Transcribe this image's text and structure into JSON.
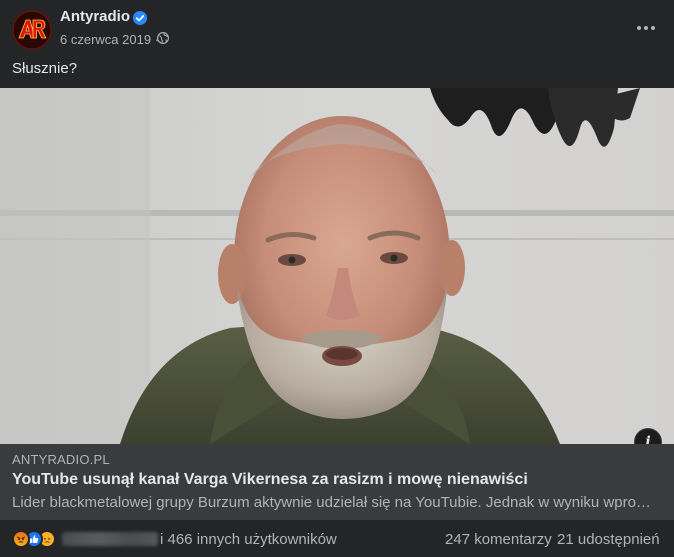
{
  "post": {
    "page_name": "Antyradio",
    "date": "6 czerwca 2019",
    "date_separator": "·",
    "text": "Słusznie?",
    "avatar_logo": "AR"
  },
  "link_card": {
    "domain": "ANTYRADIO.PL",
    "title": "YouTube usunął kanał Varga Vikernesa za rasizm i mowę nienawiści",
    "description": "Lider blackmetalowej grupy Burzum aktywnie udzielał się na YouTubie. Jednak w wyniku wpro…",
    "info_label": "i"
  },
  "reactions": {
    "icons": [
      "angry-icon",
      "like-icon",
      "sad-icon"
    ],
    "others_text": "i 466 innych użytkowników",
    "comments": "247 komentarzy",
    "shares": "21 udostępnień"
  },
  "colors": {
    "background": "#242526",
    "card_meta": "#3a3b3c",
    "primary_text": "#e4e6eb",
    "secondary_text": "#b0b3b8",
    "verified": "#2d88ff",
    "brand_red": "#e0141a"
  }
}
